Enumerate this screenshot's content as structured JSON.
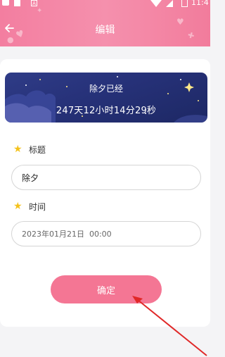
{
  "status_bar": {
    "time": "11:4"
  },
  "header": {
    "title": "编辑",
    "back_icon": "arrow-left-icon"
  },
  "banner": {
    "caption": "除夕已经",
    "countdown": "247天12小时14分29秒"
  },
  "form": {
    "title_label": "标题",
    "title_value": "除夕",
    "time_label": "时间",
    "time_value": "2023年01月21日  00:00"
  },
  "confirm_button": {
    "label": "确定"
  },
  "colors": {
    "header_pink": "#f37ea0",
    "button_pink": "#f47694",
    "banner_navy": "#27327a",
    "star_yellow": "#f4c21b",
    "annotation_red": "#e02828"
  }
}
